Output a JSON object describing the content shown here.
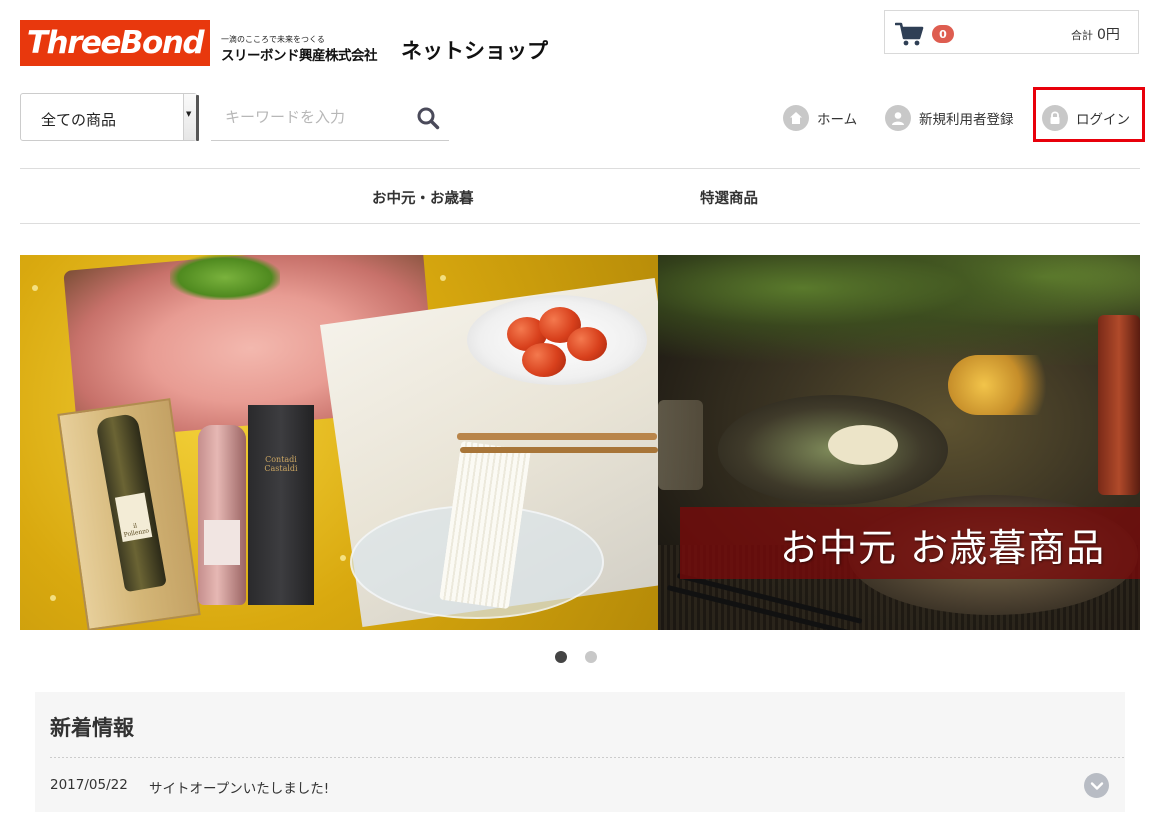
{
  "header": {
    "logo_text": "ThreeBond",
    "company_tagline": "一滴のこころで未来をつくる",
    "company_name": "スリーボンド興産株式会社",
    "shop_title": "ネットショップ"
  },
  "cart": {
    "icon": "cart-icon",
    "count": "0",
    "total_label": "合計",
    "total_value": "0円",
    "badge_color": "#de5d50"
  },
  "search": {
    "category_selected": "全ての商品",
    "placeholder": "キーワードを入力",
    "icon": "search-icon"
  },
  "nav": {
    "home": "ホーム",
    "register": "新規利用者登録",
    "login": "ログイン",
    "highlight_color": "#e8000b"
  },
  "categories": [
    {
      "label": "お中元・お歳暮"
    },
    {
      "label": "特選商品"
    }
  ],
  "banner": {
    "caption": "お中元 お歳暮商品",
    "gift_brand": "Contadi Castaldi",
    "wine_label": "il Pollenzo",
    "slides_total": 2,
    "active_slide": 1
  },
  "news": {
    "title": "新着情報",
    "items": [
      {
        "date": "2017/05/22",
        "text": "サイトオープンいたしました!"
      }
    ]
  },
  "colors": {
    "brand": "#e8380d"
  }
}
